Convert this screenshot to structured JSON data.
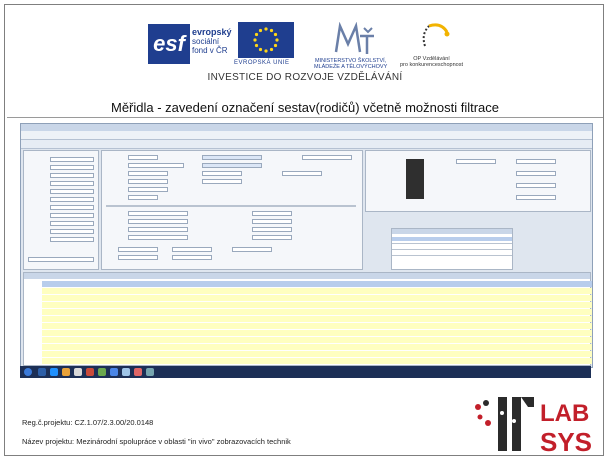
{
  "header": {
    "esf": {
      "mark": "esf",
      "line1": "evropský",
      "line2": "sociální",
      "line3": "fond v ČR"
    },
    "eu_label": "EVROPSKÁ UNIE",
    "msmt_label_1": "MINISTERSTVO ŠKOLSTVÍ,",
    "msmt_label_2": "MLÁDEŽE A TĚLOVÝCHOVY",
    "op_label_1": "OP Vzdělávání",
    "op_label_2": "pro konkurenceschopnost",
    "investice": "INVESTICE DO ROZVOJE VZDĚLÁVÁNÍ"
  },
  "slide_title": "Měřidla - zavedení označení sestav(rodičů) včetně možnosti filtrace",
  "footer": {
    "reg": "Reg.č.projektu: CZ.1.07/2.3.00/20.0148",
    "name": "Název projektu: Mezinárodní spolupráce v oblasti \"in vivo\" zobrazovacích technik"
  },
  "colors": {
    "brand_blue": "#1f3e8f",
    "table_highlight": "#ffffc0",
    "taskbar": "#1c2f56",
    "logo_red": "#c21f2a",
    "logo_dark": "#2b2b2b"
  }
}
